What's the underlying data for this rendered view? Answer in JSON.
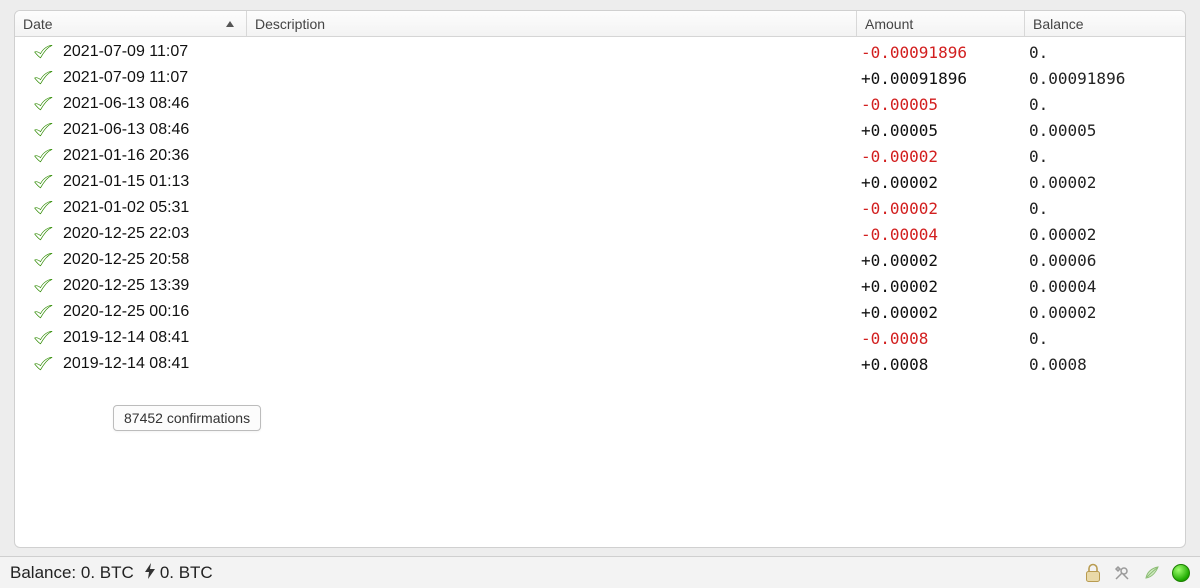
{
  "columns": {
    "date": "Date",
    "description": "Description",
    "amount": "Amount",
    "balance": "Balance"
  },
  "tooltip": "87452 confirmations",
  "transactions": [
    {
      "date": "2021-07-09 11:07",
      "description": "",
      "amount": "-0.00091896",
      "amount_sign": "neg",
      "balance": "0."
    },
    {
      "date": "2021-07-09 11:07",
      "description": "",
      "amount": "+0.00091896",
      "amount_sign": "pos",
      "balance": "0.00091896"
    },
    {
      "date": "2021-06-13 08:46",
      "description": "",
      "amount": "-0.00005",
      "amount_sign": "neg",
      "balance": "0."
    },
    {
      "date": "2021-06-13 08:46",
      "description": "",
      "amount": "+0.00005",
      "amount_sign": "pos",
      "balance": "0.00005"
    },
    {
      "date": "2021-01-16 20:36",
      "description": "",
      "amount": "-0.00002",
      "amount_sign": "neg",
      "balance": "0."
    },
    {
      "date": "2021-01-15 01:13",
      "description": "",
      "amount": "+0.00002",
      "amount_sign": "pos",
      "balance": "0.00002"
    },
    {
      "date": "2021-01-02 05:31",
      "description": "",
      "amount": "-0.00002",
      "amount_sign": "neg",
      "balance": "0."
    },
    {
      "date": "2020-12-25 22:03",
      "description": "",
      "amount": "-0.00004",
      "amount_sign": "neg",
      "balance": "0.00002"
    },
    {
      "date": "2020-12-25 20:58",
      "description": "",
      "amount": "+0.00002",
      "amount_sign": "pos",
      "balance": "0.00006"
    },
    {
      "date": "2020-12-25 13:39",
      "description": "",
      "amount": "+0.00002",
      "amount_sign": "pos",
      "balance": "0.00004"
    },
    {
      "date": "2020-12-25 00:16",
      "description": "",
      "amount": "+0.00002",
      "amount_sign": "pos",
      "balance": "0.00002"
    },
    {
      "date": "2019-12-14 08:41",
      "description": "",
      "amount": "-0.0008",
      "amount_sign": "neg",
      "balance": "0."
    },
    {
      "date": "2019-12-14 08:41",
      "description": "",
      "amount": "+0.0008",
      "amount_sign": "pos",
      "balance": "0.0008"
    }
  ],
  "statusbar": {
    "balance_label": "Balance:",
    "balance_value": "0. BTC",
    "lightning_value": "0. BTC"
  },
  "icons": {
    "check": "check-icon",
    "lock": "lock-icon",
    "tools": "tools-icon",
    "seed": "seed-icon",
    "network": "network-status-icon"
  }
}
